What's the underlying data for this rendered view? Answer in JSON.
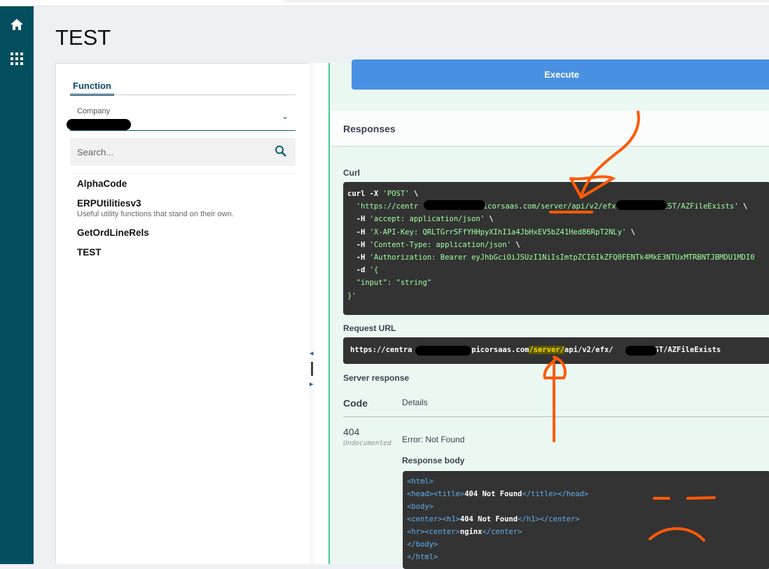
{
  "page": {
    "title": "TEST"
  },
  "rail": {
    "icons": [
      "home-icon",
      "apps-grid-icon"
    ]
  },
  "left": {
    "tab": "Function",
    "company_label": "Company",
    "search_placeholder": "Search...",
    "items": [
      {
        "name": "AlphaCode",
        "desc": ""
      },
      {
        "name": "ERPUtilitiesv3",
        "desc": "Useful utility functions that stand on their own."
      },
      {
        "name": "GetOrdLineRels",
        "desc": ""
      },
      {
        "name": "TEST",
        "desc": ""
      }
    ]
  },
  "right": {
    "execute": "Execute",
    "responses": "Responses",
    "curl_label": "Curl",
    "curl": {
      "l1a": "curl -X ",
      "l1b": "'POST'",
      "l1c": " \\",
      "l2a": "  'https://centr",
      "l2b": "epicorsaas.com/server/api/v2/efx",
      "l2c": "/TEST/AZFileExists'",
      "l2d": " \\",
      "l3a": "  -H ",
      "l3b": "'accept: application/json'",
      "l3c": " \\",
      "l4a": "  -H ",
      "l4b": "'X-API-Key: QRLTGrrSFfYHHpyXIhI1a4JbHxEV5bZ41Hed86RpT2NLy'",
      "l4c": " \\",
      "l5a": "  -H ",
      "l5b": "'Content-Type: application/json'",
      "l5c": " \\",
      "l6a": "  -H ",
      "l6b": "'Authorization: Bearer eyJhbGciOiJSUzI1NiIsImtpZCI6IkZFQ0FENTk4MkE3NTUxMTRBNTJBMDU1MDI0",
      "l7a": "  -d ",
      "l7b": "'{",
      "l8": "  \"input\": \"string\"",
      "l9": "}'"
    },
    "request_url_label": "Request URL",
    "request_url": {
      "a": "https://centra",
      "b": ".epicorsaas.com",
      "c": "/server/",
      "d": "api/v2/efx/",
      "e": "'TEST/AZFileExists"
    },
    "server_response_label": "Server response",
    "code_header": "Code",
    "details_header": "Details",
    "status_code": "404",
    "status_note": "Undocumented",
    "error_text": "Error: Not Found",
    "response_body_label": "Response body",
    "body": {
      "l1": "<html>",
      "l2a": "<head><title>",
      "l2b": "404 Not Found",
      "l2c": "</title></head>",
      "l3": "<body>",
      "l4a": "<center><h1>",
      "l4b": "404 Not Found",
      "l4c": "</h1></center>",
      "l5a": "<hr><center>",
      "l5b": "nginx",
      "l5c": "</center>",
      "l6": "</body>",
      "l7": "</html>"
    }
  },
  "colors": {
    "rail": "#044f5f",
    "execute": "#4990e2",
    "annotation": "#ff5a0a"
  }
}
